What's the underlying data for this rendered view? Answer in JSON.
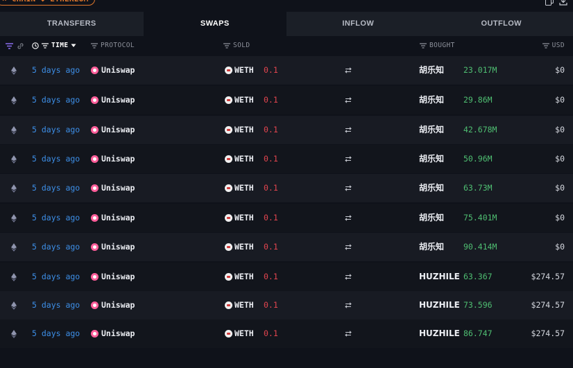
{
  "filters": {
    "chip_label": "× CHAIN ◆ ETHEREUM"
  },
  "top_icons": [
    "copy-icon",
    "download-icon"
  ],
  "tabs": [
    {
      "label": "TRANSFERS",
      "active": false
    },
    {
      "label": "SWAPS",
      "active": true
    },
    {
      "label": "INFLOW",
      "active": false
    },
    {
      "label": "OUTFLOW",
      "active": false
    }
  ],
  "columns": {
    "time": "TIME",
    "protocol": "PROTOCOL",
    "sold": "SOLD",
    "bought": "BOUGHT",
    "usd": "USD"
  },
  "colors": {
    "time_link": "#3d8fe8",
    "sold_amount": "#e2454f",
    "bought_amount": "#4fbf72",
    "protocol_brand": "#ff5e9a"
  },
  "rows": [
    {
      "chain": "ethereum-icon",
      "time": "5 days ago",
      "protocol": "Uniswap",
      "sold_token": "WETH",
      "sold_amount": "0.1",
      "bought_token": "胡乐知",
      "bought_amount": "23.017M",
      "usd": "$0"
    },
    {
      "chain": "ethereum-icon",
      "time": "5 days ago",
      "protocol": "Uniswap",
      "sold_token": "WETH",
      "sold_amount": "0.1",
      "bought_token": "胡乐知",
      "bought_amount": "29.86M",
      "usd": "$0"
    },
    {
      "chain": "ethereum-icon",
      "time": "5 days ago",
      "protocol": "Uniswap",
      "sold_token": "WETH",
      "sold_amount": "0.1",
      "bought_token": "胡乐知",
      "bought_amount": "42.678M",
      "usd": "$0"
    },
    {
      "chain": "ethereum-icon",
      "time": "5 days ago",
      "protocol": "Uniswap",
      "sold_token": "WETH",
      "sold_amount": "0.1",
      "bought_token": "胡乐知",
      "bought_amount": "50.96M",
      "usd": "$0"
    },
    {
      "chain": "ethereum-icon",
      "time": "5 days ago",
      "protocol": "Uniswap",
      "sold_token": "WETH",
      "sold_amount": "0.1",
      "bought_token": "胡乐知",
      "bought_amount": "63.73M",
      "usd": "$0"
    },
    {
      "chain": "ethereum-icon",
      "time": "5 days ago",
      "protocol": "Uniswap",
      "sold_token": "WETH",
      "sold_amount": "0.1",
      "bought_token": "胡乐知",
      "bought_amount": "75.401M",
      "usd": "$0"
    },
    {
      "chain": "ethereum-icon",
      "time": "5 days ago",
      "protocol": "Uniswap",
      "sold_token": "WETH",
      "sold_amount": "0.1",
      "bought_token": "胡乐知",
      "bought_amount": "90.414M",
      "usd": "$0"
    },
    {
      "chain": "ethereum-icon",
      "time": "5 days ago",
      "protocol": "Uniswap",
      "sold_token": "WETH",
      "sold_amount": "0.1",
      "bought_token": "HUZHILE",
      "bought_amount": "63.367",
      "usd": "$274.57"
    },
    {
      "chain": "ethereum-icon",
      "time": "5 days ago",
      "protocol": "Uniswap",
      "sold_token": "WETH",
      "sold_amount": "0.1",
      "bought_token": "HUZHILE",
      "bought_amount": "73.596",
      "usd": "$274.57"
    },
    {
      "chain": "ethereum-icon",
      "time": "5 days ago",
      "protocol": "Uniswap",
      "sold_token": "WETH",
      "sold_amount": "0.1",
      "bought_token": "HUZHILE",
      "bought_amount": "86.747",
      "usd": "$274.57"
    }
  ]
}
